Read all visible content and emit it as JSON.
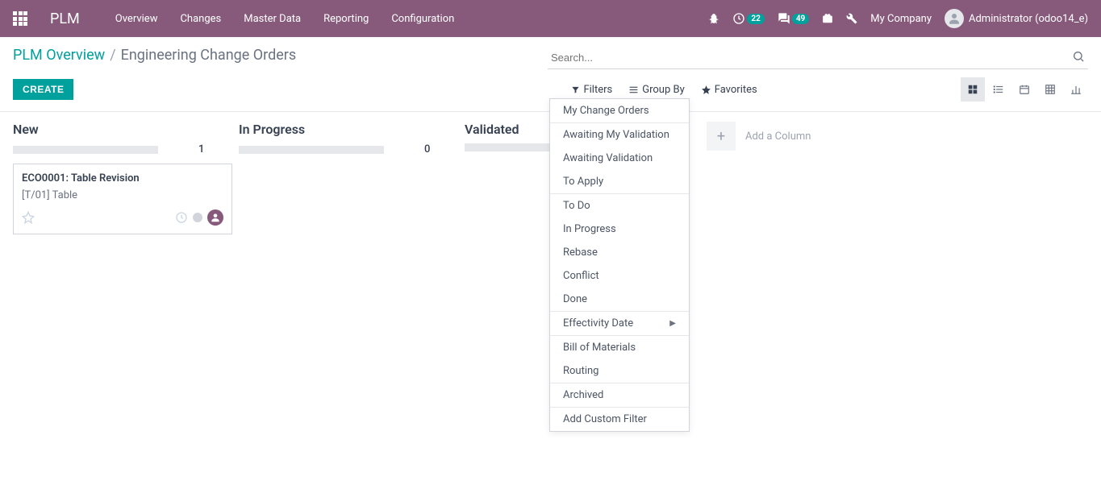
{
  "topnav": {
    "brand": "PLM",
    "items": [
      "Overview",
      "Changes",
      "Master Data",
      "Reporting",
      "Configuration"
    ],
    "activity_badge": "22",
    "messages_badge": "49",
    "company": "My Company",
    "user": "Administrator (odoo14_e)"
  },
  "breadcrumb": {
    "root": "PLM Overview",
    "current": "Engineering Change Orders"
  },
  "buttons": {
    "create": "CREATE"
  },
  "search": {
    "placeholder": "Search...",
    "filters_label": "Filters",
    "groupby_label": "Group By",
    "favorites_label": "Favorites"
  },
  "kanban": {
    "columns": [
      {
        "title": "New",
        "count": "1"
      },
      {
        "title": "In Progress",
        "count": "0"
      },
      {
        "title": "Validated",
        "count": ""
      }
    ],
    "card": {
      "title": "ECO0001: Table Revision",
      "subtitle": "[T/01] Table"
    },
    "add_column": "Add a Column"
  },
  "filters_dropdown": {
    "group1": [
      "My Change Orders"
    ],
    "group2": [
      "Awaiting My Validation",
      "Awaiting Validation",
      "To Apply"
    ],
    "group3": [
      "To Do",
      "In Progress",
      "Rebase",
      "Conflict",
      "Done"
    ],
    "group4": [
      "Effectivity Date"
    ],
    "group5": [
      "Bill of Materials",
      "Routing"
    ],
    "group6": [
      "Archived"
    ],
    "group7": [
      "Add Custom Filter"
    ]
  }
}
